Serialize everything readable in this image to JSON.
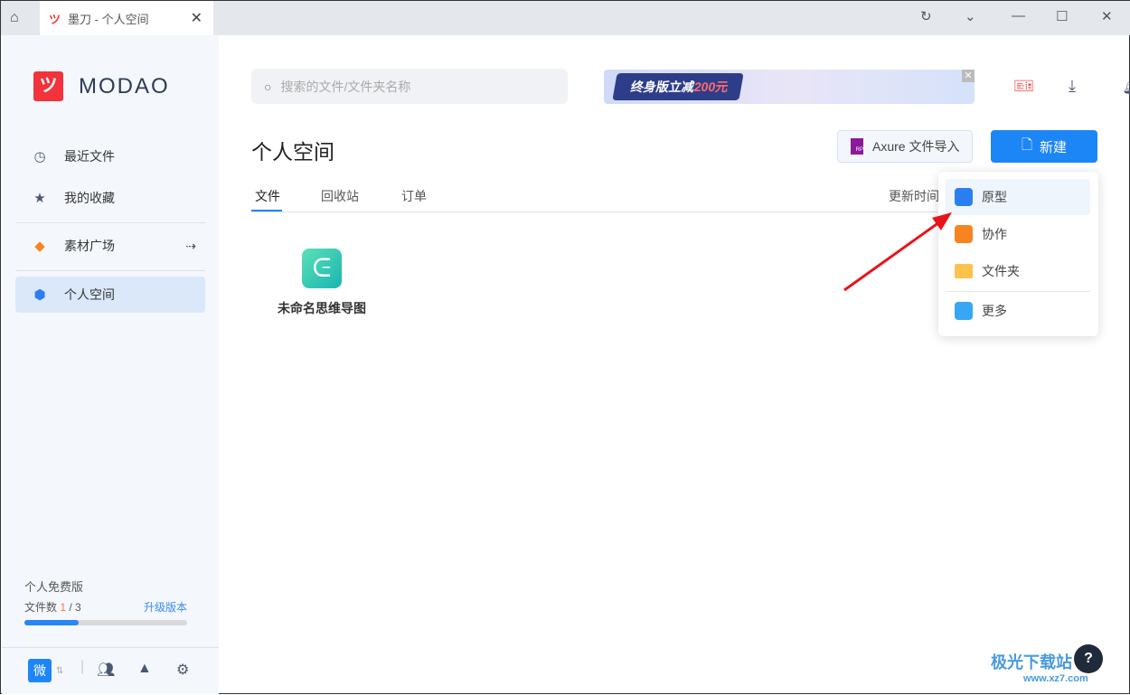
{
  "titlebar": {
    "tab_title": "墨刀 - 个人空间",
    "tab_logo": "ツ",
    "close": "✕",
    "controls": [
      "refresh-icon",
      "chevron-down-icon",
      "minimize-icon",
      "maximize-icon",
      "close-icon"
    ]
  },
  "sidebar": {
    "brand": "MODAO",
    "brand_mark": "ツ",
    "items": [
      {
        "label": "最近文件",
        "icon": "clock-icon"
      },
      {
        "label": "我的收藏",
        "icon": "star-icon"
      },
      {
        "label": "素材广场",
        "icon": "shapes-icon",
        "arrow": "⇢"
      },
      {
        "label": "个人空间",
        "icon": "cube-icon"
      }
    ],
    "plan": "个人免费版",
    "count_label": "文件数",
    "count_used": "1",
    "count_total": " / 3",
    "upgrade": "升级版本",
    "usage_fraction": 0.333,
    "footer": {
      "workspace": "微"
    }
  },
  "header": {
    "search_placeholder": "搜索的文件/文件夹名称",
    "banner_text": "终身版立减",
    "banner_amount": "200元",
    "banner_close": "✕"
  },
  "main": {
    "title": "个人空间",
    "axure_label": "Axure 文件导入",
    "new_label": "新建",
    "tabs": [
      {
        "label": "文件"
      },
      {
        "label": "回收站"
      },
      {
        "label": "订单"
      }
    ],
    "sort_label": "更新时间",
    "files": [
      {
        "name": "未命名思维导图",
        "type": "mindmap"
      }
    ]
  },
  "menu": {
    "items": [
      {
        "label": "原型",
        "color": "#2a7ff0"
      },
      {
        "label": "协作",
        "color": "#f7841f"
      },
      {
        "label": "文件夹",
        "color": "#fcc24e"
      },
      {
        "label": "更多",
        "color": "#37a6f5"
      }
    ]
  },
  "help": "?",
  "watermark": {
    "text": "极光下载站",
    "url": "www.xz7.com"
  },
  "colors": {
    "accent": "#1d86f7",
    "brand": "#f2333b",
    "annotation_arrow": "#e8141b"
  }
}
